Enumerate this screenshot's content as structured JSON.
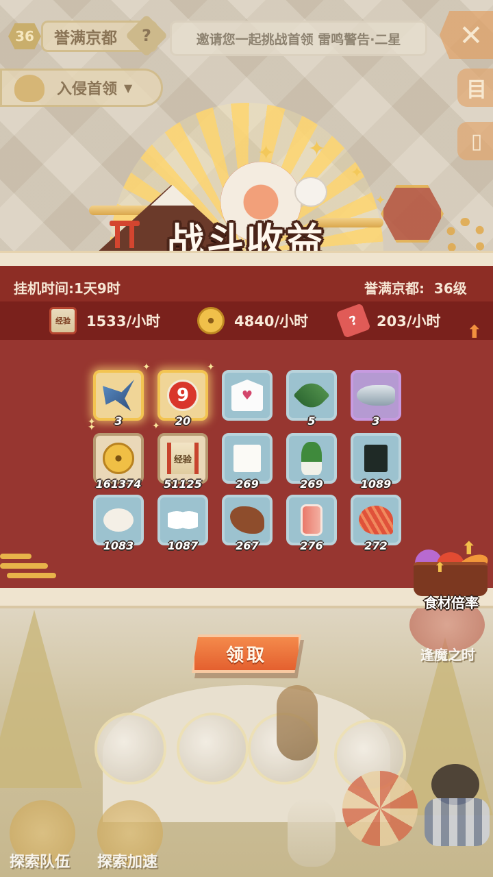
{
  "hud": {
    "level": "36",
    "map_name": "誉满京都",
    "help_glyph": "?",
    "invite_text": "邀请您一起挑战首领 雷鸣警告·二星",
    "close_glyph": "✕",
    "invade_label": "入侵首领",
    "invade_arrow": "▼",
    "side_btn_1": "目",
    "side_btn_2": "▯"
  },
  "banner": {
    "title": "战斗收益"
  },
  "summary": {
    "idle_time": "挂机时间:1天9时",
    "region_level": "誉满京都:  36级",
    "rates": [
      {
        "icon": "exp-scroll-icon",
        "icon_text": "经验",
        "value": "1533/小时"
      },
      {
        "icon": "coin-icon",
        "icon_text": "",
        "value": "4840/小时"
      },
      {
        "icon": "ticket-icon",
        "icon_text": "?",
        "value": "203/小时"
      }
    ],
    "up_arrow": "⬆"
  },
  "items": [
    {
      "icon": "paper-bird-icon",
      "count": "3",
      "frame": "gold"
    },
    {
      "icon": "nine-token-icon",
      "glyph": "9",
      "count": "20",
      "frame": "gold"
    },
    {
      "icon": "milk-carton-icon",
      "glyph": "♥",
      "count": "",
      "frame": "blue"
    },
    {
      "icon": "leaf-vegetable-icon",
      "count": "5",
      "frame": "blue"
    },
    {
      "icon": "fish-icon",
      "count": "3",
      "frame": "purple"
    },
    {
      "icon": "gold-coin-icon",
      "count": "161374",
      "frame": "brown"
    },
    {
      "icon": "exp-scroll-icon",
      "glyph": "经验",
      "count": "51125",
      "frame": "brown"
    },
    {
      "icon": "tofu-icon",
      "count": "269",
      "frame": "blue"
    },
    {
      "icon": "bok-choy-icon",
      "count": "269",
      "frame": "blue"
    },
    {
      "icon": "seaweed-icon",
      "count": "1089",
      "frame": "blue"
    },
    {
      "icon": "flour-icon",
      "count": "1083",
      "frame": "blue"
    },
    {
      "icon": "rice-icon",
      "count": "1087",
      "frame": "blue"
    },
    {
      "icon": "eel-icon",
      "count": "267",
      "frame": "blue"
    },
    {
      "icon": "meat-icon",
      "count": "276",
      "frame": "blue"
    },
    {
      "icon": "shrimp-icon",
      "count": "272",
      "frame": "blue"
    }
  ],
  "food_multiplier": {
    "label": "食材倍率"
  },
  "claim_button": {
    "label": "领取"
  },
  "background": {
    "boss_time_label": "逢魔之时",
    "explore_team_label": "探索队伍",
    "explore_speed_label": "探索加速"
  },
  "colors": {
    "panel_red": "#8d2d25",
    "claim_orange": "#e4602f",
    "gold_frame": "#f3c451",
    "blue_frame": "#b9d3db"
  }
}
